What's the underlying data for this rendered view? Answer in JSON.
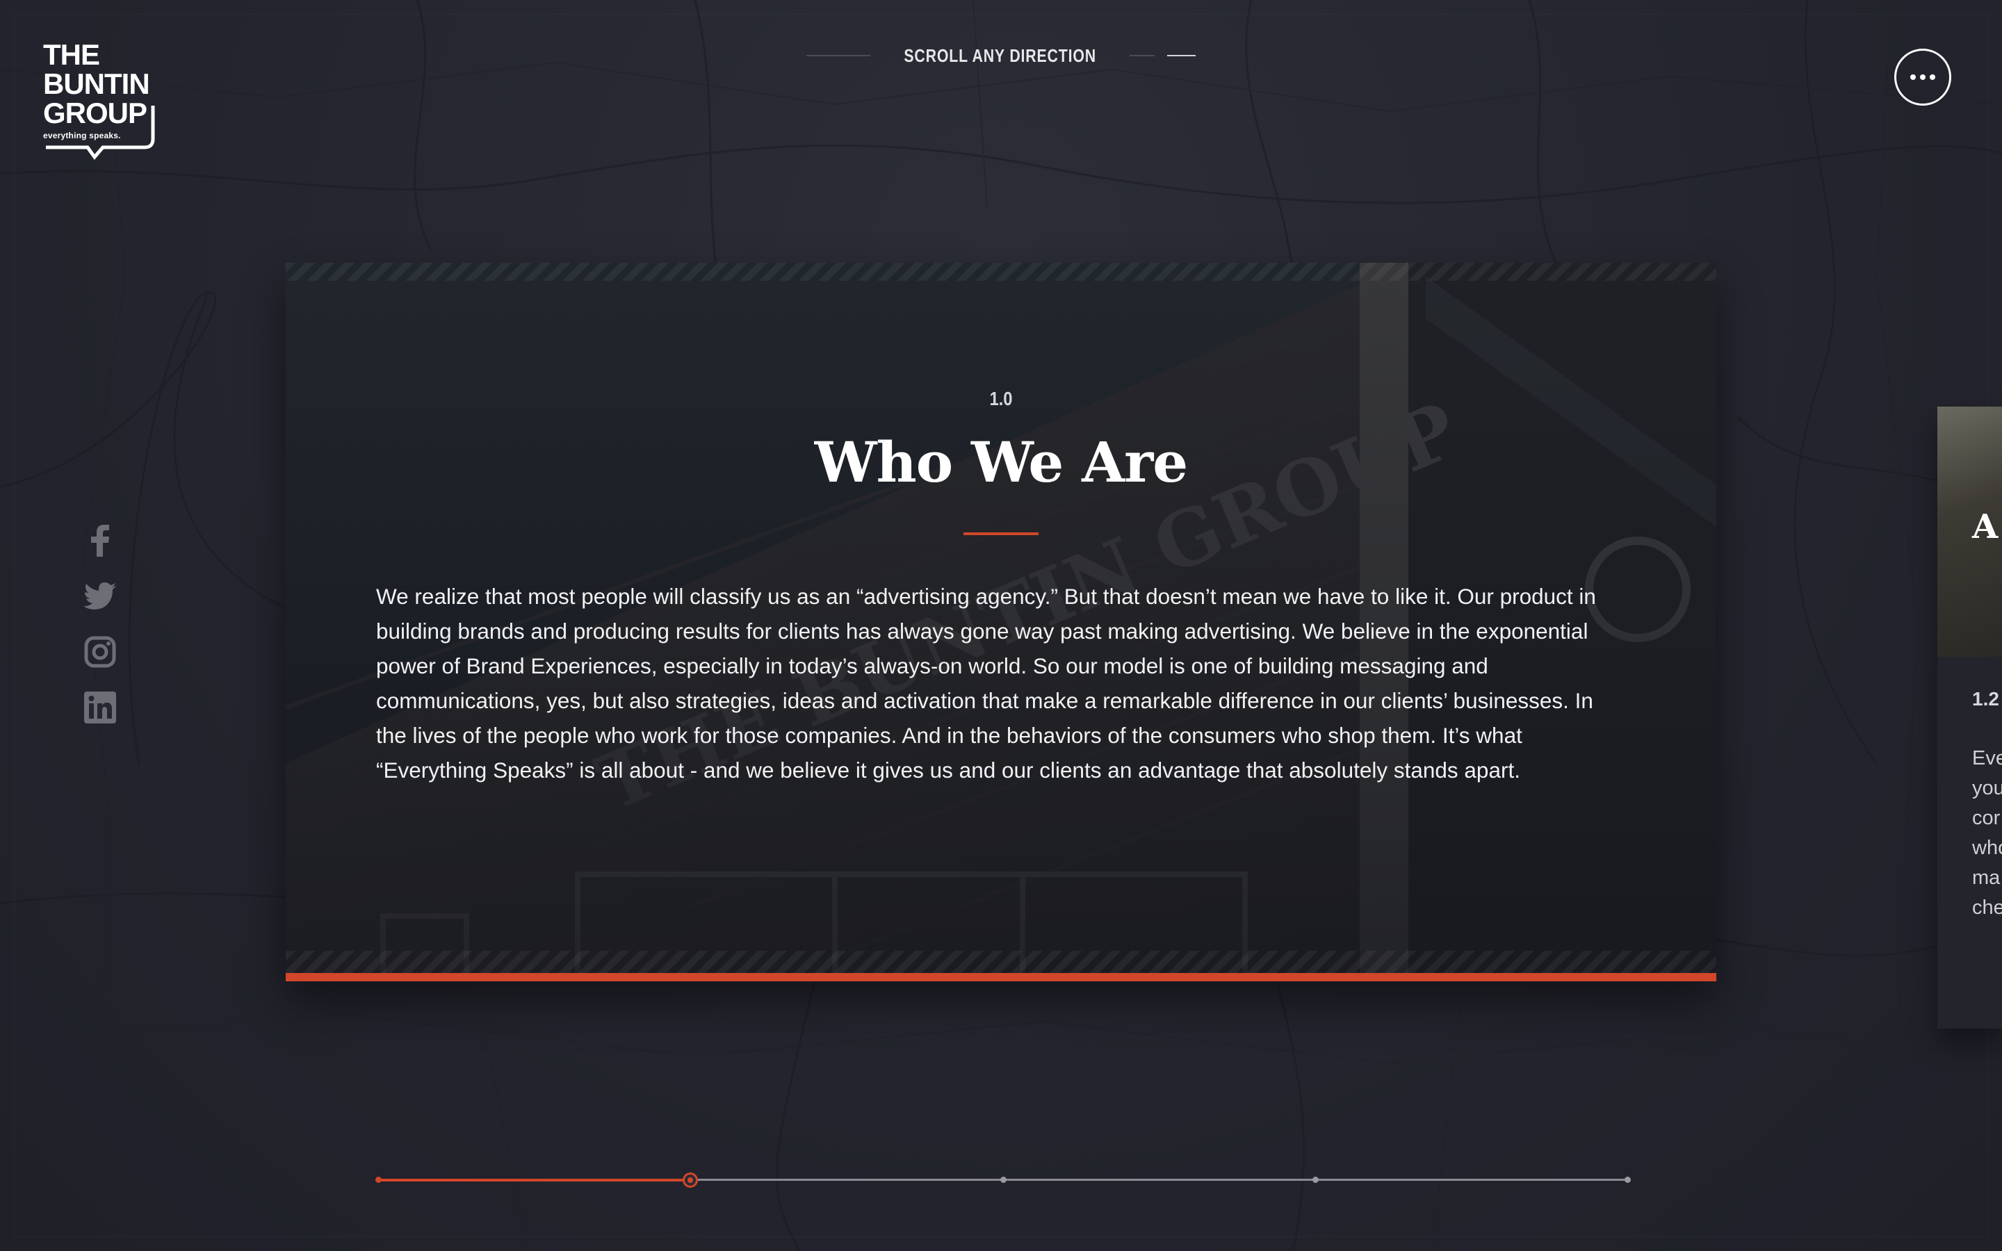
{
  "brand": {
    "logo_lines": [
      "THE",
      "BUNTIN",
      "GROUP"
    ],
    "tagline": "everything speaks."
  },
  "header": {
    "scroll_hint": "SCROLL ANY DIRECTION",
    "menu_label": "Menu"
  },
  "social": [
    {
      "icon": "facebook-icon"
    },
    {
      "icon": "twitter-icon"
    },
    {
      "icon": "instagram-icon"
    },
    {
      "icon": "linkedin-icon"
    }
  ],
  "section": {
    "number": "1.0",
    "title": "Who We Are",
    "body": "We realize that most people will classify us as an “advertising agency.” But that doesn’t mean we have to like it. Our product in building brands and producing results for clients has always gone way past making advertising. We believe in the exponential power of Brand Experiences, especially in today’s always-on world. So our model is one of building messaging and communications, yes, but also strategies, ideas and activation that make a remarkable difference in our clients’ businesses. In the lives of the people who work for those companies. And in the behaviors of the consumers who shop them. It’s what “Everything Speaks” is all about - and we believe it gives us and our clients an advantage that absolutely stands apart."
  },
  "next_section": {
    "number": "1.2",
    "title_fragment": "A",
    "text_fragment": "Eve\nyou\ncor\nwho\nma\nche"
  },
  "progress": {
    "steps": 5,
    "current_index": 1,
    "fraction": 0.25
  },
  "colors": {
    "accent": "#d2462a",
    "background": "#25262f",
    "text": "#ffffff"
  }
}
